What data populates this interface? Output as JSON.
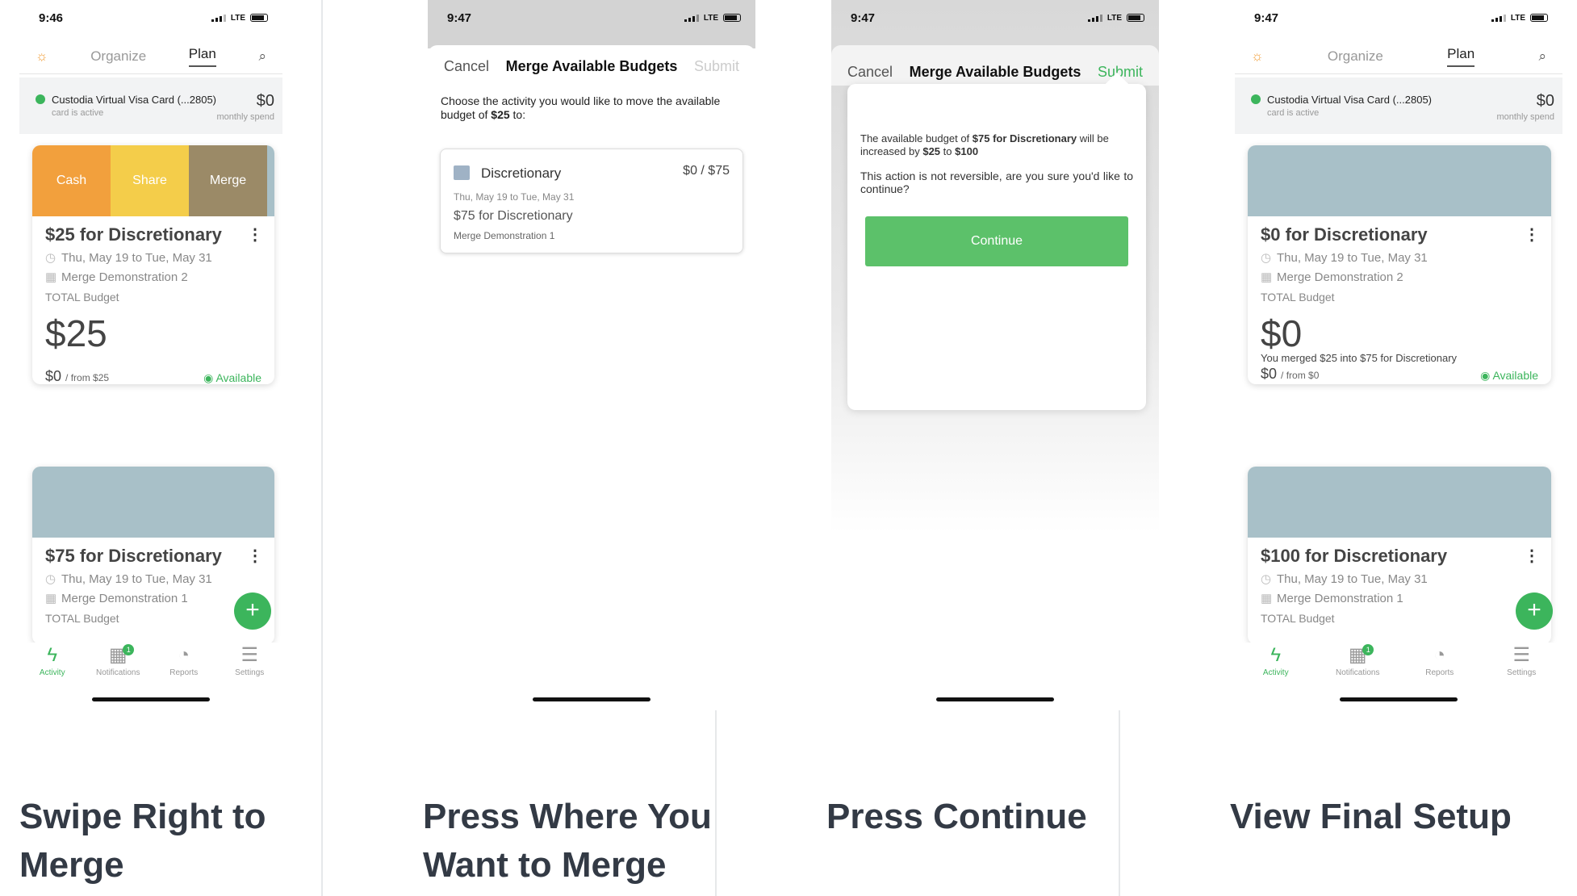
{
  "colors": {
    "green": "#3cb55c",
    "cash": "#f2a03d",
    "share": "#f4cd4a",
    "merge": "#9b8a67",
    "caption": "#333a45"
  },
  "panels": [
    {
      "caption": "Swipe Right to Merge",
      "status": {
        "time": "9:46",
        "carrier": "LTE"
      },
      "nav": {
        "organize": "Organize",
        "plan": "Plan"
      },
      "cardbar": {
        "name": "Custodia Virtual Visa Card (...2805)",
        "sub": "card is active",
        "amount": "$0",
        "amount_sub": "monthly spend"
      },
      "swipe_actions": [
        "Cash",
        "Share",
        "Merge"
      ],
      "card1": {
        "title": "$25 for Discretionary",
        "dates": "Thu, May 19 to Tue, May 31",
        "group": "Merge Demonstration 2",
        "total_label": "TOTAL Budget",
        "total": "$25",
        "spent": "$0",
        "from": "/ from $25",
        "status": "Available",
        "progress": 0
      },
      "card2": {
        "title": "$75 for Discretionary",
        "dates": "Thu, May 19 to Tue, May 31",
        "group": "Merge Demonstration 1",
        "total_label": "TOTAL Budget"
      },
      "tabs": [
        {
          "label": "Activity",
          "icon": "lightning-icon"
        },
        {
          "label": "Notifications",
          "icon": "grid-icon",
          "badge": "1"
        },
        {
          "label": "Reports",
          "icon": "pie-icon"
        },
        {
          "label": "Settings",
          "icon": "sliders-icon"
        }
      ]
    },
    {
      "caption": "Press Where You Want to Merge",
      "status": {
        "time": "9:47",
        "carrier": "LTE"
      },
      "header": {
        "cancel": "Cancel",
        "title": "Merge Available Budgets",
        "submit": "Submit"
      },
      "instruction_a": "Choose the activity you would like to move the available budget of",
      "instruction_amount": "$25",
      "instruction_b": "to:",
      "choice": {
        "name": "Discretionary",
        "amount": "$0 / $75",
        "dates": "Thu, May 19 to Tue, May 31",
        "budget": "$75 for Discretionary",
        "group": "Merge Demonstration 1"
      }
    },
    {
      "caption": "Press Continue",
      "status": {
        "time": "9:47",
        "carrier": "LTE"
      },
      "header": {
        "cancel": "Cancel",
        "title": "Merge Available Budgets",
        "submit": "Submit"
      },
      "dialog": {
        "line_a": "The available budget of",
        "bold_a": "$75 for Discretionary",
        "line_b": "will be increased by",
        "bold_b": "$25",
        "line_c": "to",
        "bold_c": "$100",
        "warning": "This action is not reversible, are you sure you'd like to continue?",
        "button": "Continue"
      }
    },
    {
      "caption": "View Final Setup",
      "status": {
        "time": "9:47",
        "carrier": "LTE"
      },
      "nav": {
        "organize": "Organize",
        "plan": "Plan"
      },
      "cardbar": {
        "name": "Custodia Virtual Visa Card (...2805)",
        "sub": "card is active",
        "amount": "$0",
        "amount_sub": "monthly spend"
      },
      "card1": {
        "title": "$0 for Discretionary",
        "dates": "Thu, May 19 to Tue, May 31",
        "group": "Merge Demonstration 2",
        "total_label": "TOTAL Budget",
        "total": "$0",
        "note": "You merged $25 into $75 for Discretionary",
        "spent": "$0",
        "from": "/ from $0",
        "status": "Available",
        "progress": 1
      },
      "card2": {
        "title": "$100 for Discretionary",
        "dates": "Thu, May 19 to Tue, May 31",
        "group": "Merge Demonstration 1",
        "total_label": "TOTAL Budget"
      },
      "tabs": [
        {
          "label": "Activity",
          "icon": "lightning-icon"
        },
        {
          "label": "Notifications",
          "icon": "grid-icon",
          "badge": "1"
        },
        {
          "label": "Reports",
          "icon": "pie-icon"
        },
        {
          "label": "Settings",
          "icon": "sliders-icon"
        }
      ]
    }
  ]
}
